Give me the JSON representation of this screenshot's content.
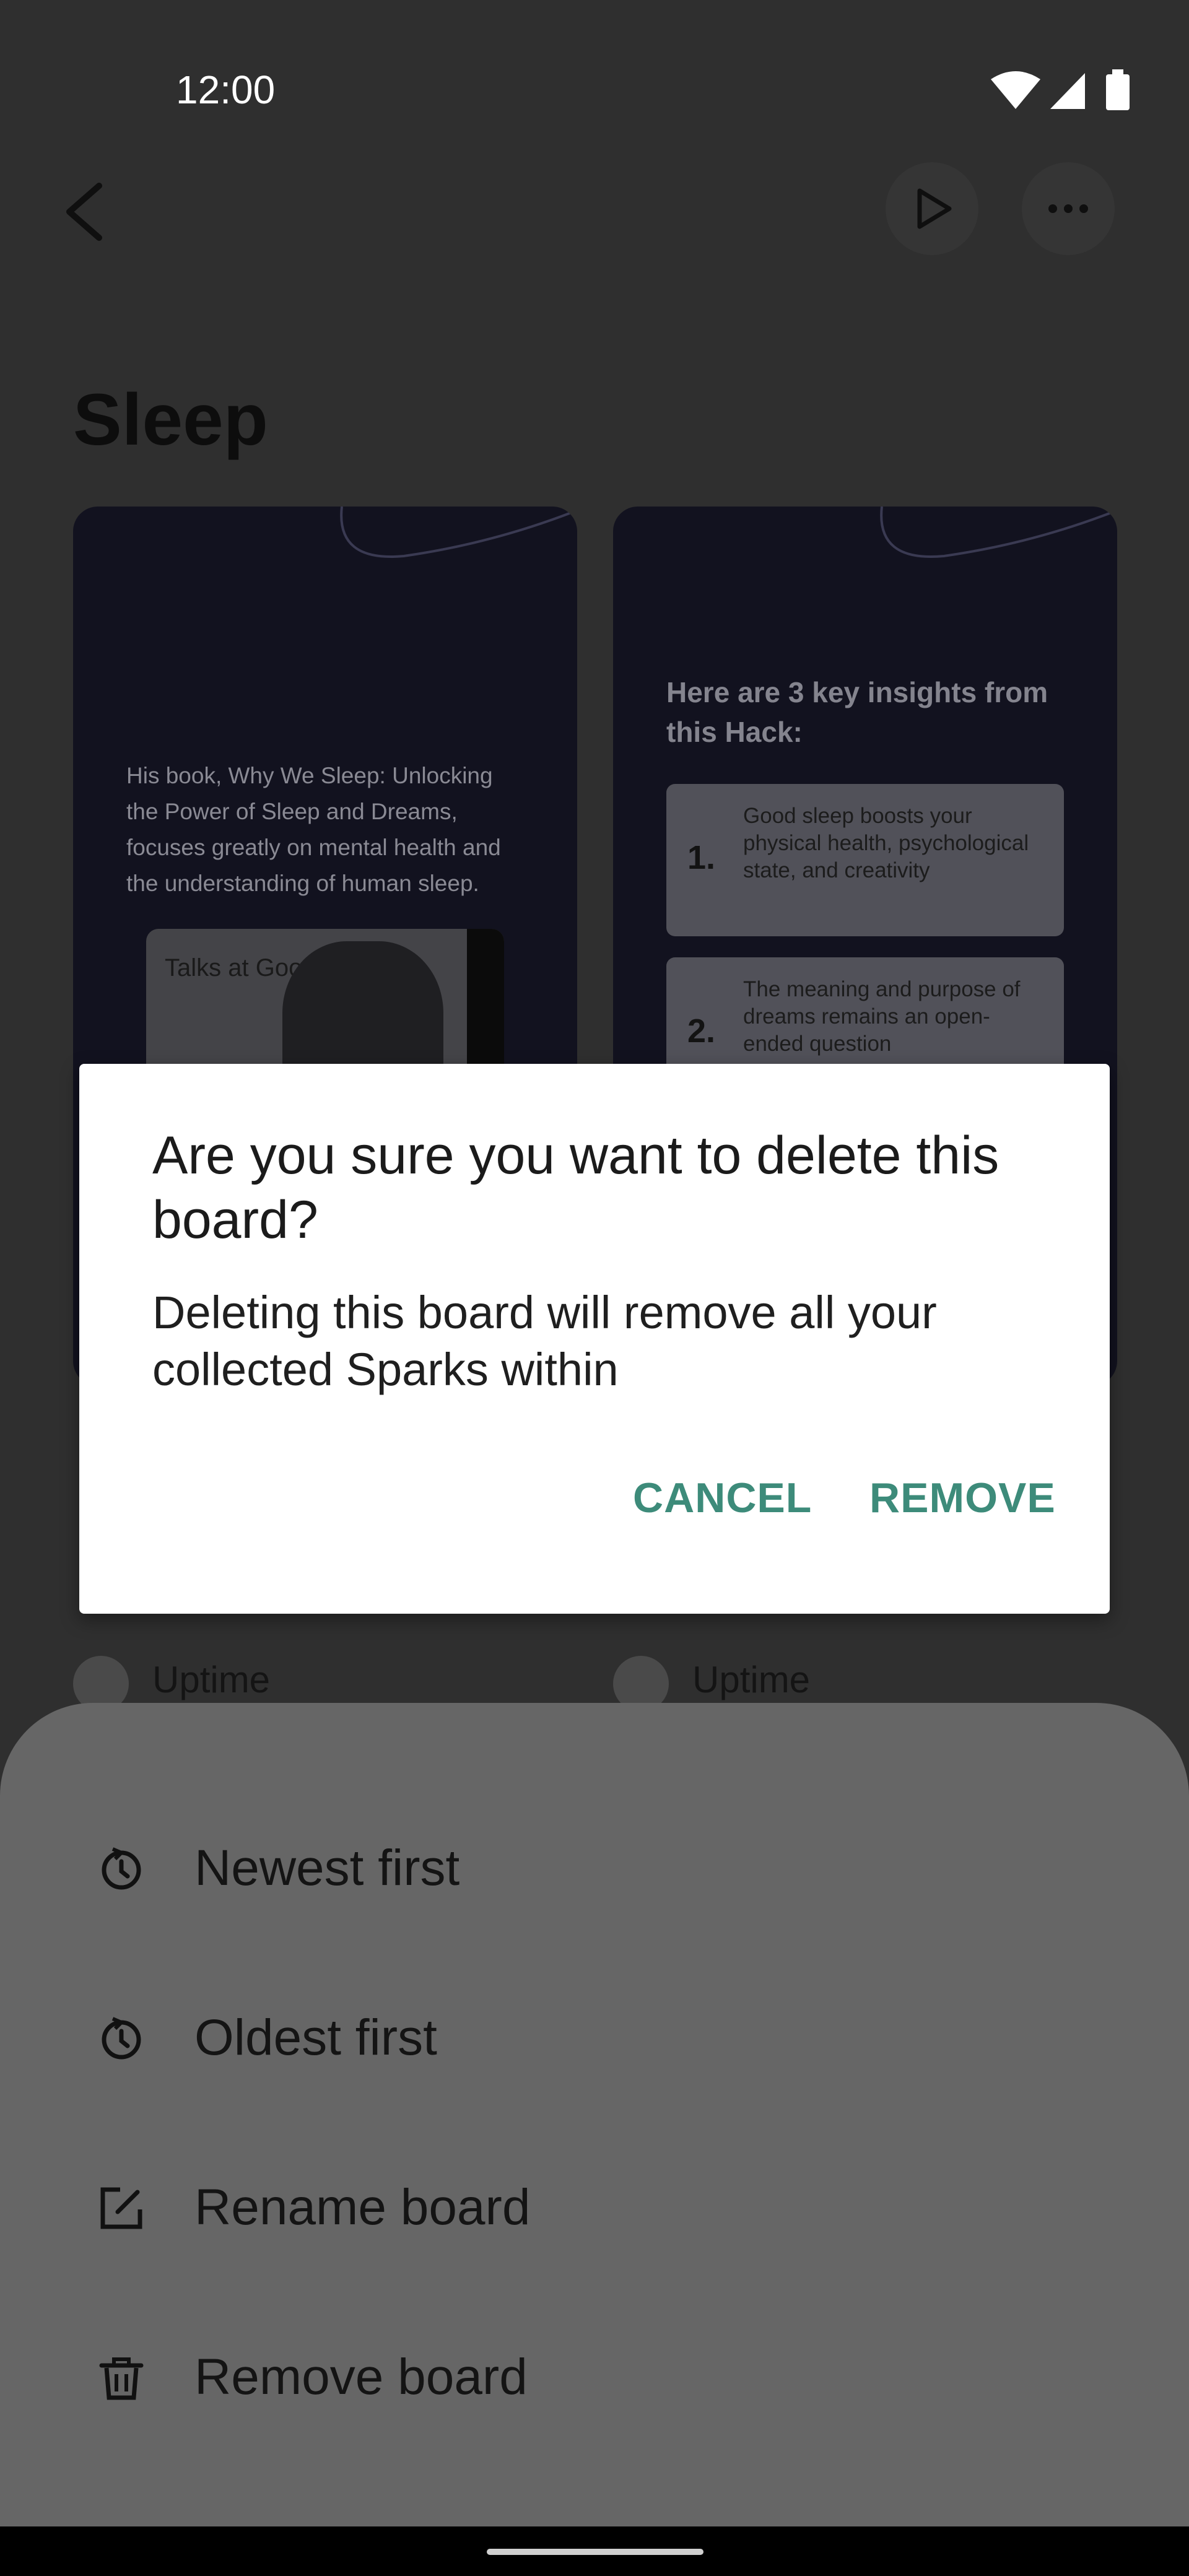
{
  "status_bar": {
    "time": "12:00",
    "icons": [
      "wifi-icon",
      "signal-icon",
      "battery-icon"
    ]
  },
  "header": {
    "title": "Sleep",
    "back_icon": "chevron-left-icon",
    "play_icon": "play-icon",
    "more_icon": "more-horizontal-icon"
  },
  "cards": [
    {
      "text": "His book, Why We Sleep: Unlocking the Power of Sleep and Dreams, focuses greatly on mental health and the understanding of human sleep.",
      "video_label": "Talks at Google",
      "source": "Uptime"
    },
    {
      "title": "Here are 3 key insights from this Hack:",
      "insights": [
        {
          "num": "1.",
          "text": "Good sleep boosts your physical health, psychological state, and creativity"
        },
        {
          "num": "2.",
          "text": "The meaning and purpose of dreams remains an open-ended question"
        }
      ],
      "source": "Uptime"
    }
  ],
  "sheet": {
    "items": [
      {
        "label": "Newest first",
        "icon": "clock-icon"
      },
      {
        "label": "Oldest first",
        "icon": "clock-icon"
      },
      {
        "label": "Rename board",
        "icon": "edit-icon"
      },
      {
        "label": "Remove board",
        "icon": "trash-icon"
      }
    ]
  },
  "dialog": {
    "title": "Are you sure you want to delete this board?",
    "body": "Deleting this board will remove all your collected Sparks within",
    "cancel_label": "CANCEL",
    "remove_label": "REMOVE",
    "accent_color": "#3d8b7a"
  },
  "colors": {
    "scrim": "#000000",
    "sheet": "#666666",
    "card_background": "#12121f"
  }
}
